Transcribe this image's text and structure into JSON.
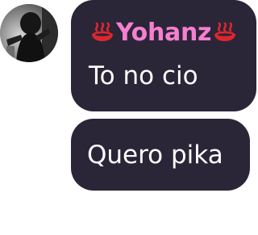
{
  "messages": [
    {
      "sender": "Yohanz",
      "sender_decoration_icon": "hot-springs-icon",
      "text": "To no cio"
    },
    {
      "text": "Quero pika"
    }
  ],
  "colors": {
    "bubble": "#2b2538",
    "sender_name": "#f57fd0",
    "message_text": "#ffffff",
    "icon": "#e0262d"
  }
}
